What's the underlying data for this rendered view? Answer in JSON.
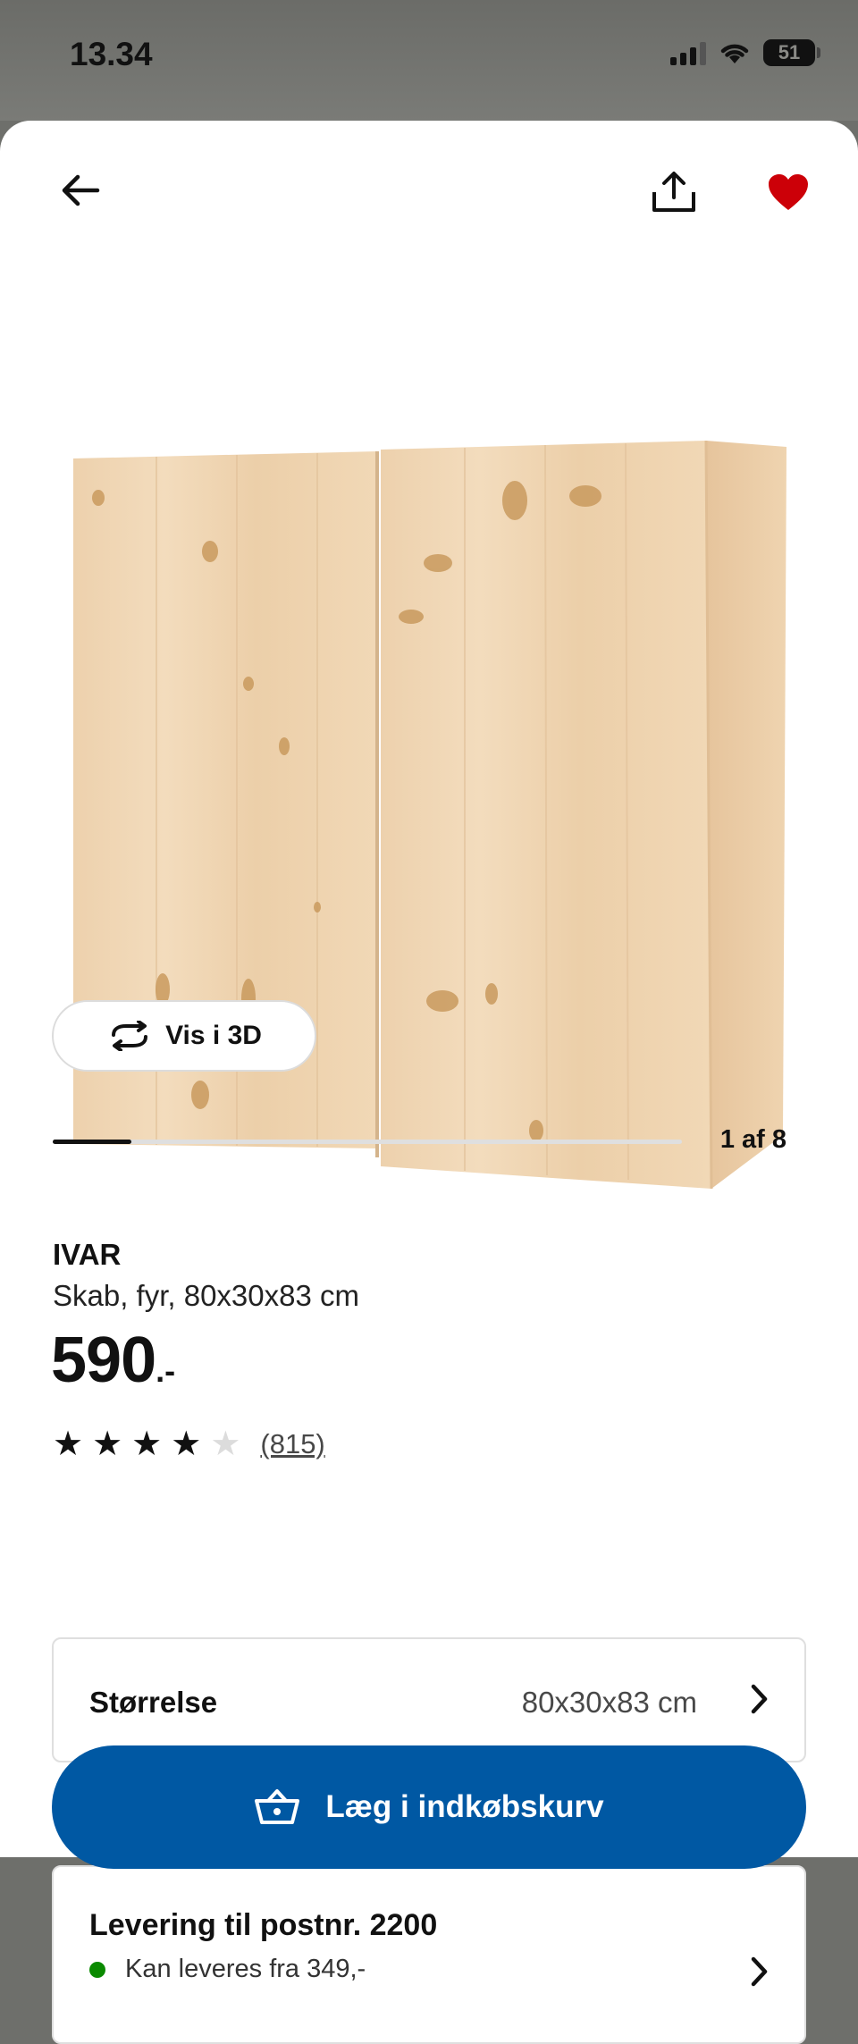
{
  "status_bar": {
    "time": "13.34",
    "battery": "51"
  },
  "product": {
    "name": "IVAR",
    "description": "Skab, fyr, 80x30x83 cm",
    "price_main": "590",
    "price_suffix": ".-",
    "rating_stars": 4,
    "rating_max": 5,
    "review_count": "(815)"
  },
  "gallery": {
    "view3d_label": "Vis i 3D",
    "image_index": 1,
    "image_total": 8,
    "counter_label": "1 af 8"
  },
  "size": {
    "label": "Størrelse",
    "value": "80x30x83 cm"
  },
  "cart_button": {
    "label": "Læg i indkøbskurv"
  },
  "delivery": {
    "title": "Levering til postnr. 2200",
    "status": "Kan leveres fra 349,-"
  },
  "colors": {
    "primary_blue": "#0058a3",
    "favorite_red": "#cc0008",
    "stock_green": "#0a8a00"
  },
  "icons": [
    "back-arrow-icon",
    "share-icon",
    "heart-icon",
    "rotate-3d-icon",
    "star-icon",
    "chevron-right-icon",
    "basket-icon"
  ]
}
